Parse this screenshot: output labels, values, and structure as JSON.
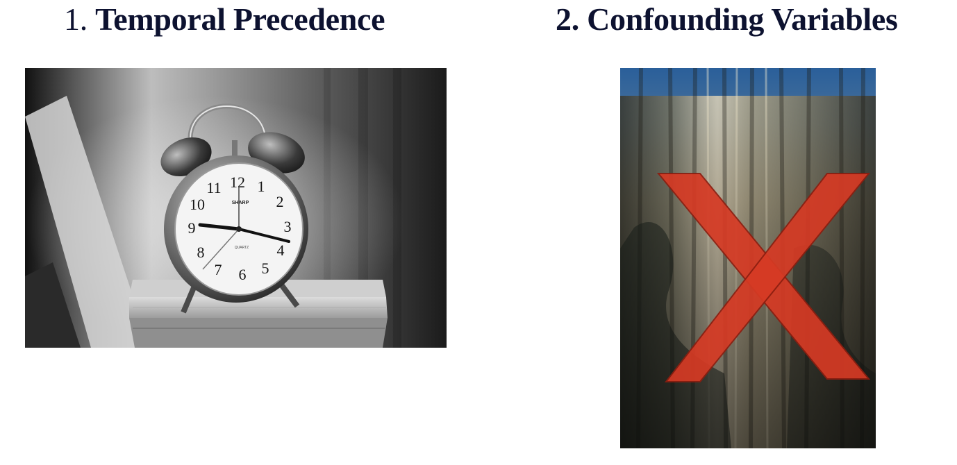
{
  "sections": [
    {
      "number": "1.",
      "title": "Temporal Precedence",
      "image": "alarm-clock-photo"
    },
    {
      "number": "2.",
      "title": "Confounding Variables",
      "image": "curtain-with-red-x-photo"
    }
  ],
  "clock_photo": {
    "brand_text": "SHARP",
    "dial_text": "QUARTZ",
    "numerals": [
      "12",
      "1",
      "2",
      "3",
      "4",
      "5",
      "6",
      "7",
      "8",
      "9",
      "10",
      "11"
    ]
  },
  "colors": {
    "heading": "#0d1230",
    "x_mark": "#d63a24"
  }
}
